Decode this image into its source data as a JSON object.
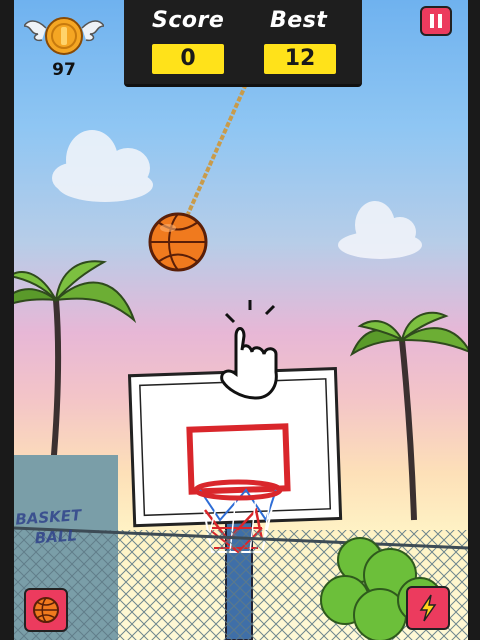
{
  "hud": {
    "coins": "97",
    "score_label": "Score",
    "score_value": "0",
    "best_label": "Best",
    "best_value": "12"
  },
  "scene": {
    "graffiti_line1": "BASKET",
    "graffiti_line2": "BALL"
  },
  "colors": {
    "button_red": "#ec3b5e",
    "score_yellow": "#ffe21a",
    "ball_orange": "#f07a1e",
    "hoop_red": "#d9262b"
  },
  "icons": {
    "pause": "pause-icon",
    "ball_shop": "basketball-icon",
    "powerup": "lightning-icon",
    "hint": "tap-hand-icon"
  }
}
